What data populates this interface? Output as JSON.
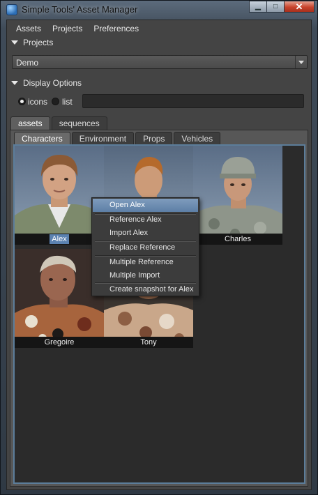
{
  "window": {
    "title": "Simple Tools' Asset Manager",
    "controls": {
      "minimize": "▁",
      "maximize": "□",
      "close": "✕"
    }
  },
  "menubar": [
    "Assets",
    "Projects",
    "Preferences"
  ],
  "projects_section": {
    "header": "Projects",
    "project_dropdown": {
      "selected": "Demo"
    }
  },
  "display_options": {
    "header": "Display Options",
    "view_modes": [
      {
        "label": "icons",
        "selected": true
      },
      {
        "label": "list",
        "selected": false
      }
    ],
    "filter_value": ""
  },
  "main_tabs": [
    {
      "label": "assets",
      "active": true
    },
    {
      "label": "sequences",
      "active": false
    }
  ],
  "category_tabs": [
    {
      "label": "Characters",
      "active": true
    },
    {
      "label": "Environment",
      "active": false
    },
    {
      "label": "Props",
      "active": false
    },
    {
      "label": "Vehicles",
      "active": false
    }
  ],
  "assets": [
    {
      "name": "Alex",
      "selected": true
    },
    {
      "name": "Charles",
      "selected": false
    },
    {
      "name": "Gregoire",
      "selected": false
    },
    {
      "name": "Tony",
      "selected": false
    }
  ],
  "context_menu": {
    "items": [
      {
        "label": "Open Alex",
        "highlighted": true
      },
      {
        "label": "Reference Alex"
      },
      {
        "label": "Import Alex"
      },
      {
        "label": "Replace Reference"
      },
      {
        "label": "Multiple Reference"
      },
      {
        "label": "Multiple Import"
      },
      {
        "label": "Create snapshot for Alex"
      }
    ]
  },
  "colors": {
    "selection_accent": "#5b82b0",
    "viewport_border": "#5c7d9a",
    "menu_highlight": "#6f8fb4"
  }
}
